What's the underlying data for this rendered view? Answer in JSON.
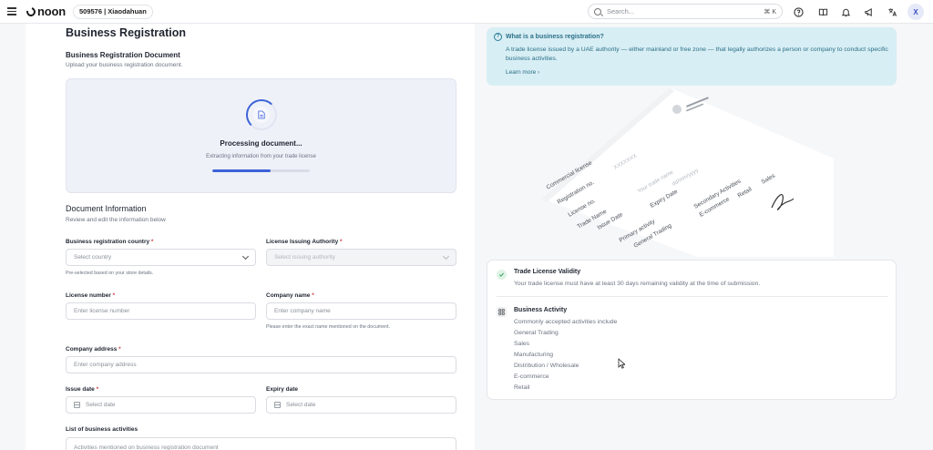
{
  "topbar": {
    "logo_text": "noon",
    "store_label": "509576 | Xiaodahuan",
    "search_placeholder": "Search...",
    "search_shortcut": "⌘ K",
    "avatar_initial": "X"
  },
  "page": {
    "title": "Business Registration"
  },
  "upload": {
    "title": "Business Registration Document",
    "subtitle": "Upload your business registration document.",
    "processing_title": "Processing document...",
    "processing_subtitle": "Extracting information from your trade license",
    "progress_fraction": 0.6
  },
  "doc_info": {
    "title": "Document Information",
    "subtitle": "Review and edit the information below",
    "country_label": "Business registration country",
    "country_placeholder": "Select country",
    "country_hint": "Pre-selected based on your store details.",
    "authority_label": "License Issuing Authority",
    "authority_placeholder": "Select issuing authority",
    "license_number_label": "License number",
    "license_number_placeholder": "Enter license number",
    "company_name_label": "Company name",
    "company_name_placeholder": "Enter company name",
    "company_name_hint": "Please enter the exact name mentioned on the document.",
    "address_label": "Company address",
    "address_placeholder": "Enter company address",
    "issue_date_label": "Issue date",
    "issue_date_placeholder": "Select date",
    "expiry_date_label": "Expiry date",
    "expiry_date_placeholder": "Select date",
    "activities_label": "List of business activities",
    "activities_placeholder": "Activities mentioned on business registration document",
    "required_mark": "*"
  },
  "info_box": {
    "title": "What is a business registration?",
    "body": "A trade license issued by a UAE authority — either mainland or free zone — that legally authorizes a person or company to conduct specific business activities.",
    "link": "Learn more ›"
  },
  "license_sample": {
    "lines": [
      "Commercial license",
      "Registration no.",
      "License no.",
      "Trade Name",
      "Issue Date",
      "Expiry Date",
      "Primary activity",
      "General Trading",
      "Secondary Activities",
      "E-commerce",
      "Retail",
      "Sales",
      "Your trade name",
      "XXXXXXX",
      "dd/mm/yyyy"
    ]
  },
  "validity": {
    "title": "Trade License Validity",
    "text": "Your trade license must have at least 30 days remaining validity at the time of submission."
  },
  "activity": {
    "title": "Business Activity",
    "intro": "Commonly accepted activities include",
    "items": [
      "General Trading",
      "Sales",
      "Manufacturing",
      "Distribution / Wholesale",
      "E-commerce",
      "Retail"
    ]
  },
  "colors": {
    "accent": "#3d63d8",
    "info_bg": "#d7eef4",
    "info_text": "#2b6f87",
    "required": "#d14343"
  }
}
